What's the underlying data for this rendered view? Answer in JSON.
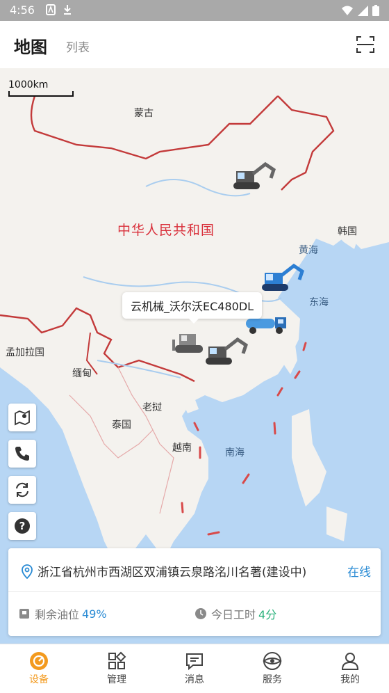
{
  "status_bar": {
    "time": "4:56"
  },
  "header": {
    "title": "地图",
    "tab_list": "列表"
  },
  "map": {
    "scale_label": "1000km",
    "labels": {
      "mongolia": "蒙古",
      "china": "中华人民共和国",
      "korea": "韩国",
      "yellow_sea": "黄海",
      "east_sea": "东海",
      "bangladesh": "孟加拉国",
      "myanmar": "缅甸",
      "laos": "老挝",
      "thailand": "泰国",
      "vietnam": "越南",
      "south_sea": "南海"
    },
    "tooltip": "云机械_沃尔沃EC480DL"
  },
  "side_buttons": [
    "map-pin-icon",
    "phone-icon",
    "refresh-icon",
    "help-icon"
  ],
  "device_card": {
    "address": "浙江省杭州市西湖区双浦镇云泉路洺川名著(建设中)",
    "status": "在线",
    "fuel_label": "剩余油位",
    "fuel_value": "49%",
    "worktime_label": "今日工时",
    "worktime_value": "4分"
  },
  "bottom_nav": [
    {
      "label": "设备",
      "icon": "device-icon",
      "active": true
    },
    {
      "label": "管理",
      "icon": "grid-icon",
      "active": false
    },
    {
      "label": "消息",
      "icon": "message-icon",
      "active": false
    },
    {
      "label": "服务",
      "icon": "service-icon",
      "active": false
    },
    {
      "label": "我的",
      "icon": "user-icon",
      "active": false
    }
  ],
  "colors": {
    "accent": "#f39a1e",
    "link": "#2a8bd4",
    "border_red": "#c33a3a",
    "sea": "#b7d6f4",
    "land": "#f4f2ee"
  }
}
